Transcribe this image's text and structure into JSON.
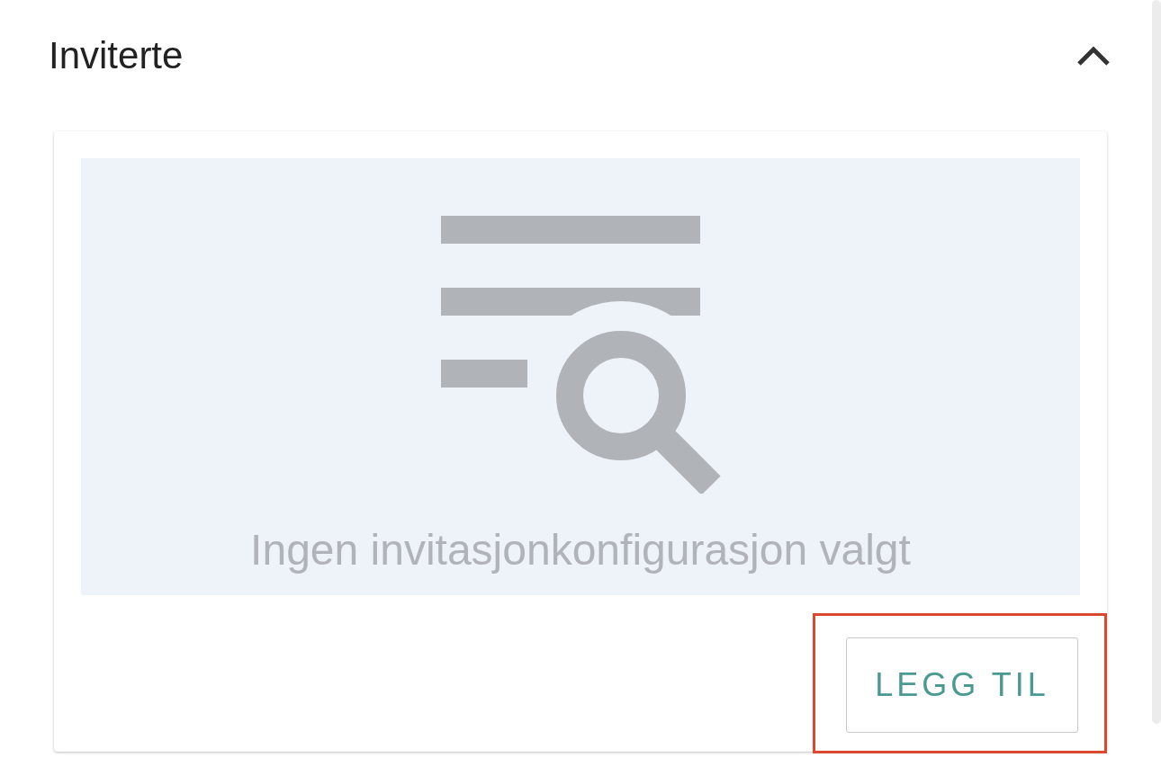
{
  "section": {
    "title": "Inviterte",
    "expanded": true
  },
  "empty_state": {
    "message": "Ingen invitasjonkonfigurasjon valgt"
  },
  "add_button": {
    "label": "LEGG TIL",
    "highlighted": true
  }
}
